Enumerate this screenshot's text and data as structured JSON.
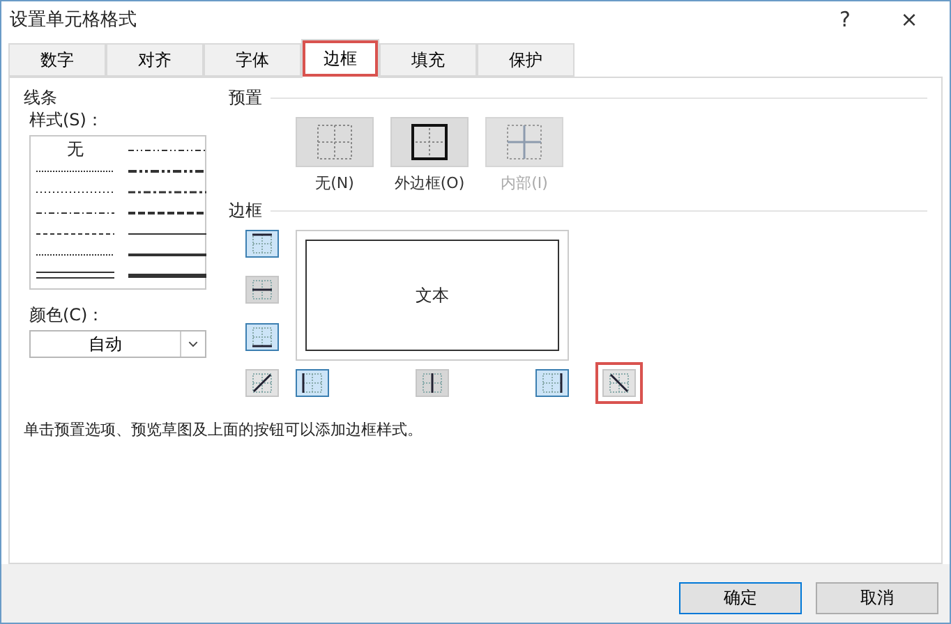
{
  "window": {
    "title": "设置单元格格式",
    "help": "?",
    "close": "×"
  },
  "tabs": [
    {
      "label": "数字",
      "selected": false,
      "highlighted": false
    },
    {
      "label": "对齐",
      "selected": false,
      "highlighted": false
    },
    {
      "label": "字体",
      "selected": false,
      "highlighted": false
    },
    {
      "label": "边框",
      "selected": true,
      "highlighted": true
    },
    {
      "label": "填充",
      "selected": false,
      "highlighted": false
    },
    {
      "label": "保护",
      "selected": false,
      "highlighted": false
    }
  ],
  "line": {
    "title": "线条",
    "style_label": "样式(S)：",
    "styles": [
      {
        "kind": "none",
        "label": "无"
      },
      {
        "kind": "dash-dot-dot"
      },
      {
        "kind": "hair"
      },
      {
        "kind": "medium-dash-dot-dot"
      },
      {
        "kind": "dotted"
      },
      {
        "kind": "dash-dot"
      },
      {
        "kind": "dash-dot-thin"
      },
      {
        "kind": "medium-dashed"
      },
      {
        "kind": "dashed-thin"
      },
      {
        "kind": "thin"
      },
      {
        "kind": "dotted-thin"
      },
      {
        "kind": "medium"
      },
      {
        "kind": "double"
      },
      {
        "kind": "thick"
      }
    ],
    "color_label": "颜色(C)：",
    "color_value": "自动"
  },
  "presets": {
    "title": "预置",
    "items": [
      {
        "kind": "none",
        "label": "无(N)",
        "disabled": false
      },
      {
        "kind": "outline",
        "label": "外边框(O)",
        "disabled": false
      },
      {
        "kind": "inside",
        "label": "内部(I)",
        "disabled": true
      }
    ]
  },
  "border": {
    "title": "边框",
    "preview_text": "文本",
    "side_buttons": [
      {
        "kind": "top",
        "selected": true,
        "disabled": false
      },
      {
        "kind": "middle-h",
        "selected": false,
        "disabled": true
      },
      {
        "kind": "bottom",
        "selected": true,
        "disabled": false
      },
      {
        "kind": "diag-up",
        "selected": false,
        "disabled": false
      }
    ],
    "bottom_buttons": [
      {
        "kind": "left",
        "selected": true,
        "disabled": false
      },
      {
        "kind": "middle-v",
        "selected": false,
        "disabled": true
      },
      {
        "kind": "right",
        "selected": true,
        "disabled": false
      },
      {
        "kind": "diag-down",
        "selected": false,
        "disabled": false,
        "highlighted": true
      }
    ]
  },
  "hint": "单击预置选项、预览草图及上面的按钮可以添加边框样式。",
  "buttons": [
    {
      "label": "确定",
      "default": true
    },
    {
      "label": "取消",
      "default": false
    }
  ]
}
